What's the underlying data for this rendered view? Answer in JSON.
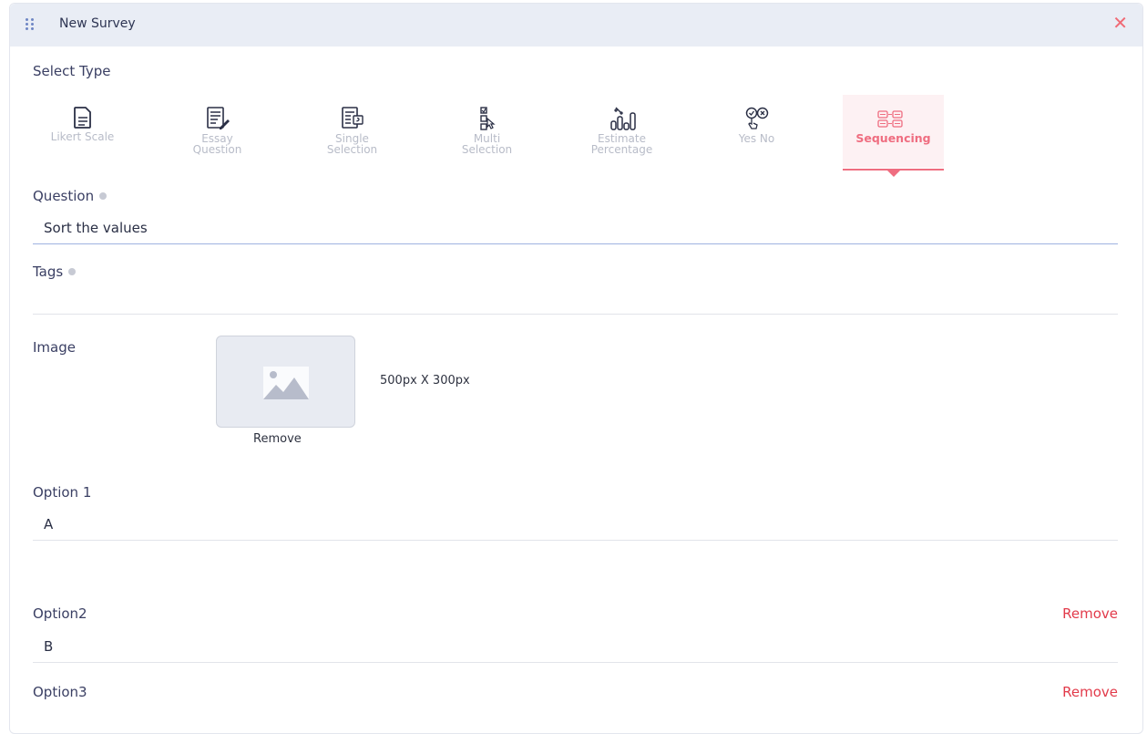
{
  "header": {
    "title": "New Survey"
  },
  "select_type": {
    "label": "Select Type",
    "items": [
      {
        "line1": "Likert Scale",
        "line2": "",
        "icon": "document-icon"
      },
      {
        "line1": "Essay",
        "line2": "Question",
        "icon": "essay-icon"
      },
      {
        "line1": "Single",
        "line2": "Selection",
        "icon": "single-selection-icon"
      },
      {
        "line1": "Multi",
        "line2": "Selection",
        "icon": "multi-selection-icon"
      },
      {
        "line1": "Estimate",
        "line2": "Percentage",
        "icon": "percentage-chart-icon"
      },
      {
        "line1": "Yes No",
        "line2": "",
        "icon": "yes-no-icon"
      },
      {
        "line1": "Sequencing",
        "line2": "",
        "icon": "sequencing-icon",
        "active": true
      }
    ]
  },
  "question": {
    "label": "Question",
    "value": "Sort the values"
  },
  "tags": {
    "label": "Tags",
    "value": ""
  },
  "image": {
    "label": "Image",
    "remove_label": "Remove",
    "size_text": "500px X 300px"
  },
  "options": [
    {
      "label": "Option 1",
      "value": "A",
      "remove_label": ""
    },
    {
      "label": "Option2",
      "value": "B",
      "remove_label": "Remove"
    },
    {
      "label": "Option3",
      "value": "",
      "remove_label": "Remove"
    }
  ],
  "colors": {
    "accent": "#ef6d80",
    "remove": "#e23a4a",
    "header_bg": "#e9edf5"
  }
}
